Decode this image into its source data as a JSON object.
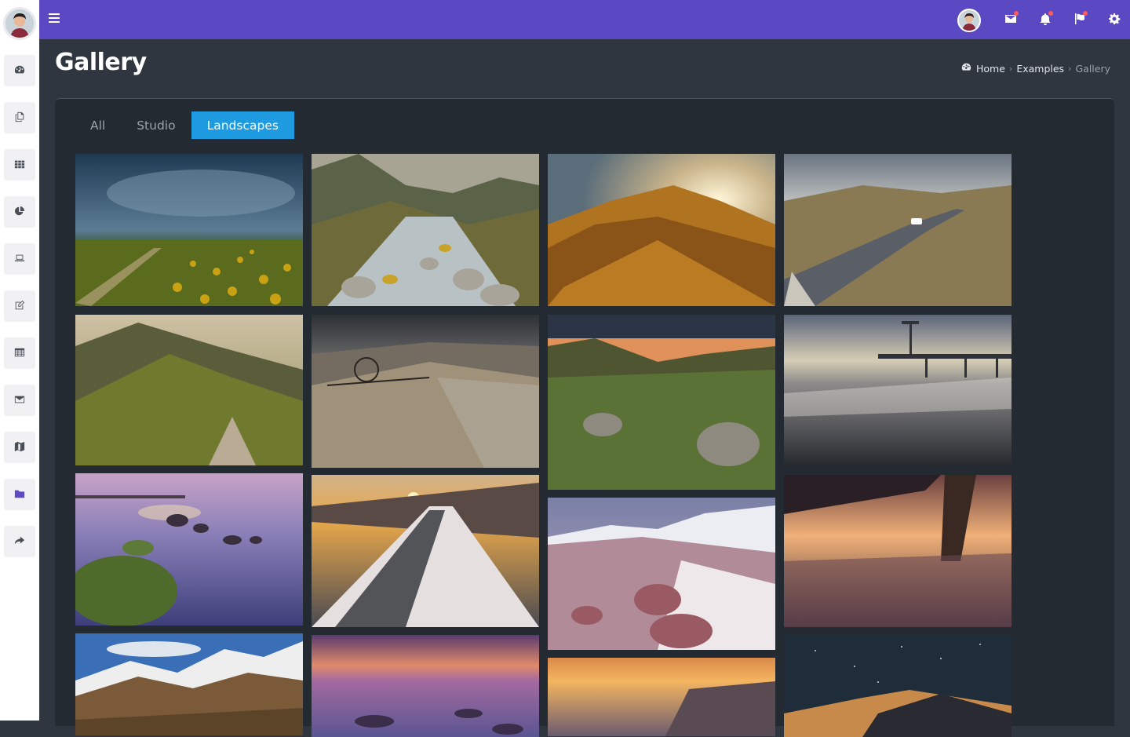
{
  "topbar": {
    "menu_icon": "hamburger-icon",
    "icons": [
      {
        "name": "mail-icon",
        "has_dot": true
      },
      {
        "name": "bell-icon",
        "has_dot": true
      },
      {
        "name": "flag-icon",
        "has_dot": true
      },
      {
        "name": "gear-icon",
        "has_dot": false
      }
    ],
    "accent_color": "#5b49c4"
  },
  "sidebar": {
    "items": [
      {
        "icon": "dashboard-icon"
      },
      {
        "icon": "copy-icon"
      },
      {
        "icon": "grid-icon"
      },
      {
        "icon": "pie-chart-icon"
      },
      {
        "icon": "laptop-icon"
      },
      {
        "icon": "edit-icon"
      },
      {
        "icon": "table-icon"
      },
      {
        "icon": "envelope-icon"
      },
      {
        "icon": "map-icon"
      },
      {
        "icon": "folder-icon",
        "active": true
      },
      {
        "icon": "share-icon"
      }
    ]
  },
  "page": {
    "title": "Gallery"
  },
  "breadcrumb": {
    "home": "Home",
    "examples": "Examples",
    "current": "Gallery"
  },
  "tabs": [
    {
      "label": "All"
    },
    {
      "label": "Studio"
    },
    {
      "label": "Landscapes",
      "active": true
    }
  ],
  "gallery": {
    "photos": [
      {
        "name": "sunflower-field-storm"
      },
      {
        "name": "mountain-river-rocks"
      },
      {
        "name": "sunset-mountain-trail"
      },
      {
        "name": "winding-road-hills"
      },
      {
        "name": "grassy-ridge-path"
      },
      {
        "name": "old-plow-grass"
      },
      {
        "name": "valley-meadow-rocks"
      },
      {
        "name": "seaside-pier"
      },
      {
        "name": "mossy-rocks-shore"
      },
      {
        "name": "snowy-road-sunset"
      },
      {
        "name": "snow-mountains-rocks"
      },
      {
        "name": "pier-pillar-sunset"
      },
      {
        "name": "snowy-peaks-valley"
      },
      {
        "name": "purple-sea-dusk"
      },
      {
        "name": "orange-sea-sunset"
      },
      {
        "name": "starry-night-hill"
      }
    ]
  }
}
